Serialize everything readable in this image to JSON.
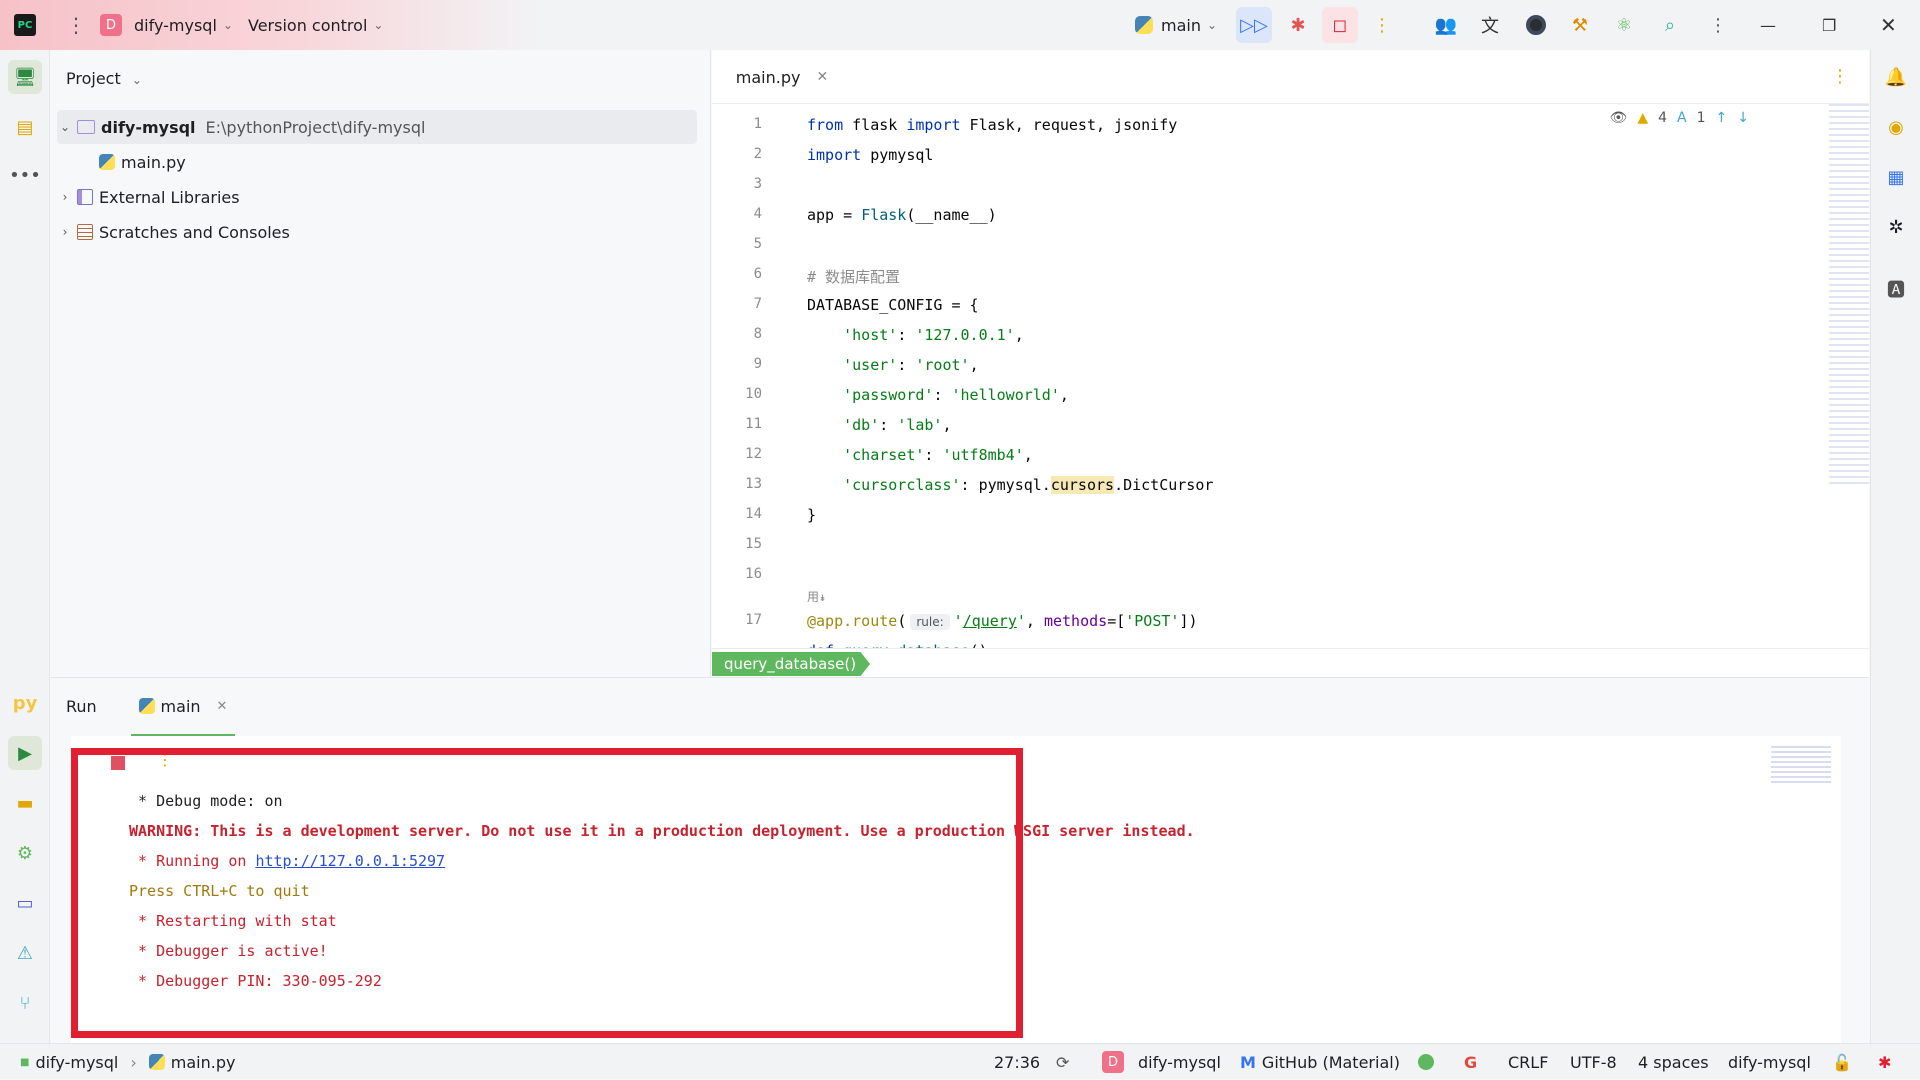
{
  "titlebar": {
    "project_badge": "D",
    "project_name": "dify-mysql",
    "version_control": "Version control",
    "run_config": "main"
  },
  "project_panel": {
    "title": "Project",
    "root_name": "dify-mysql",
    "root_path": "E:\\pythonProject\\dify-mysql",
    "items": [
      {
        "label": "main.py"
      },
      {
        "label": "External Libraries"
      },
      {
        "label": "Scratches and Consoles"
      }
    ]
  },
  "editor": {
    "tab_label": "main.py",
    "warnings": "4",
    "typos": "1",
    "breadcrumb": "query_database()",
    "line_numbers": [
      "1",
      "2",
      "3",
      "4",
      "5",
      "6",
      "7",
      "8",
      "9",
      "10",
      "11",
      "12",
      "13",
      "14",
      "15",
      "16",
      "17"
    ],
    "usages_hint": "用↡",
    "param_hint": "rule:"
  },
  "run_panel": {
    "title": "Run",
    "tab_label": "main",
    "console": [
      {
        "text": " * Debug mode: on",
        "style": "plain"
      },
      {
        "text": "WARNING: This is a development server. Do not use it in a production deployment. Use a production WSGI server instead.",
        "style": "warn"
      },
      {
        "text": " * Running on ",
        "style": "red",
        "link": "http://127.0.0.1:5297"
      },
      {
        "text": "Press CTRL+C to quit",
        "style": "yellow"
      },
      {
        "text": " * Restarting with stat",
        "style": "red"
      },
      {
        "text": " * Debugger is active!",
        "style": "red"
      },
      {
        "text": " * Debugger PIN: 330-095-292",
        "style": "red"
      }
    ]
  },
  "statusbar": {
    "crumb_project": "dify-mysql",
    "crumb_file": "main.py",
    "position": "27:36",
    "project_badge": "D",
    "project_name": "dify-mysql",
    "theme": "GitHub (Material)",
    "line_ending": "CRLF",
    "encoding": "UTF-8",
    "indent": "4 spaces",
    "interpreter": "dify-mysql"
  },
  "colors": {
    "accent_green": "#5fb85f",
    "error_red": "#c7222d",
    "highlight_box": "#e02031",
    "project_badge": "#f0708a"
  }
}
